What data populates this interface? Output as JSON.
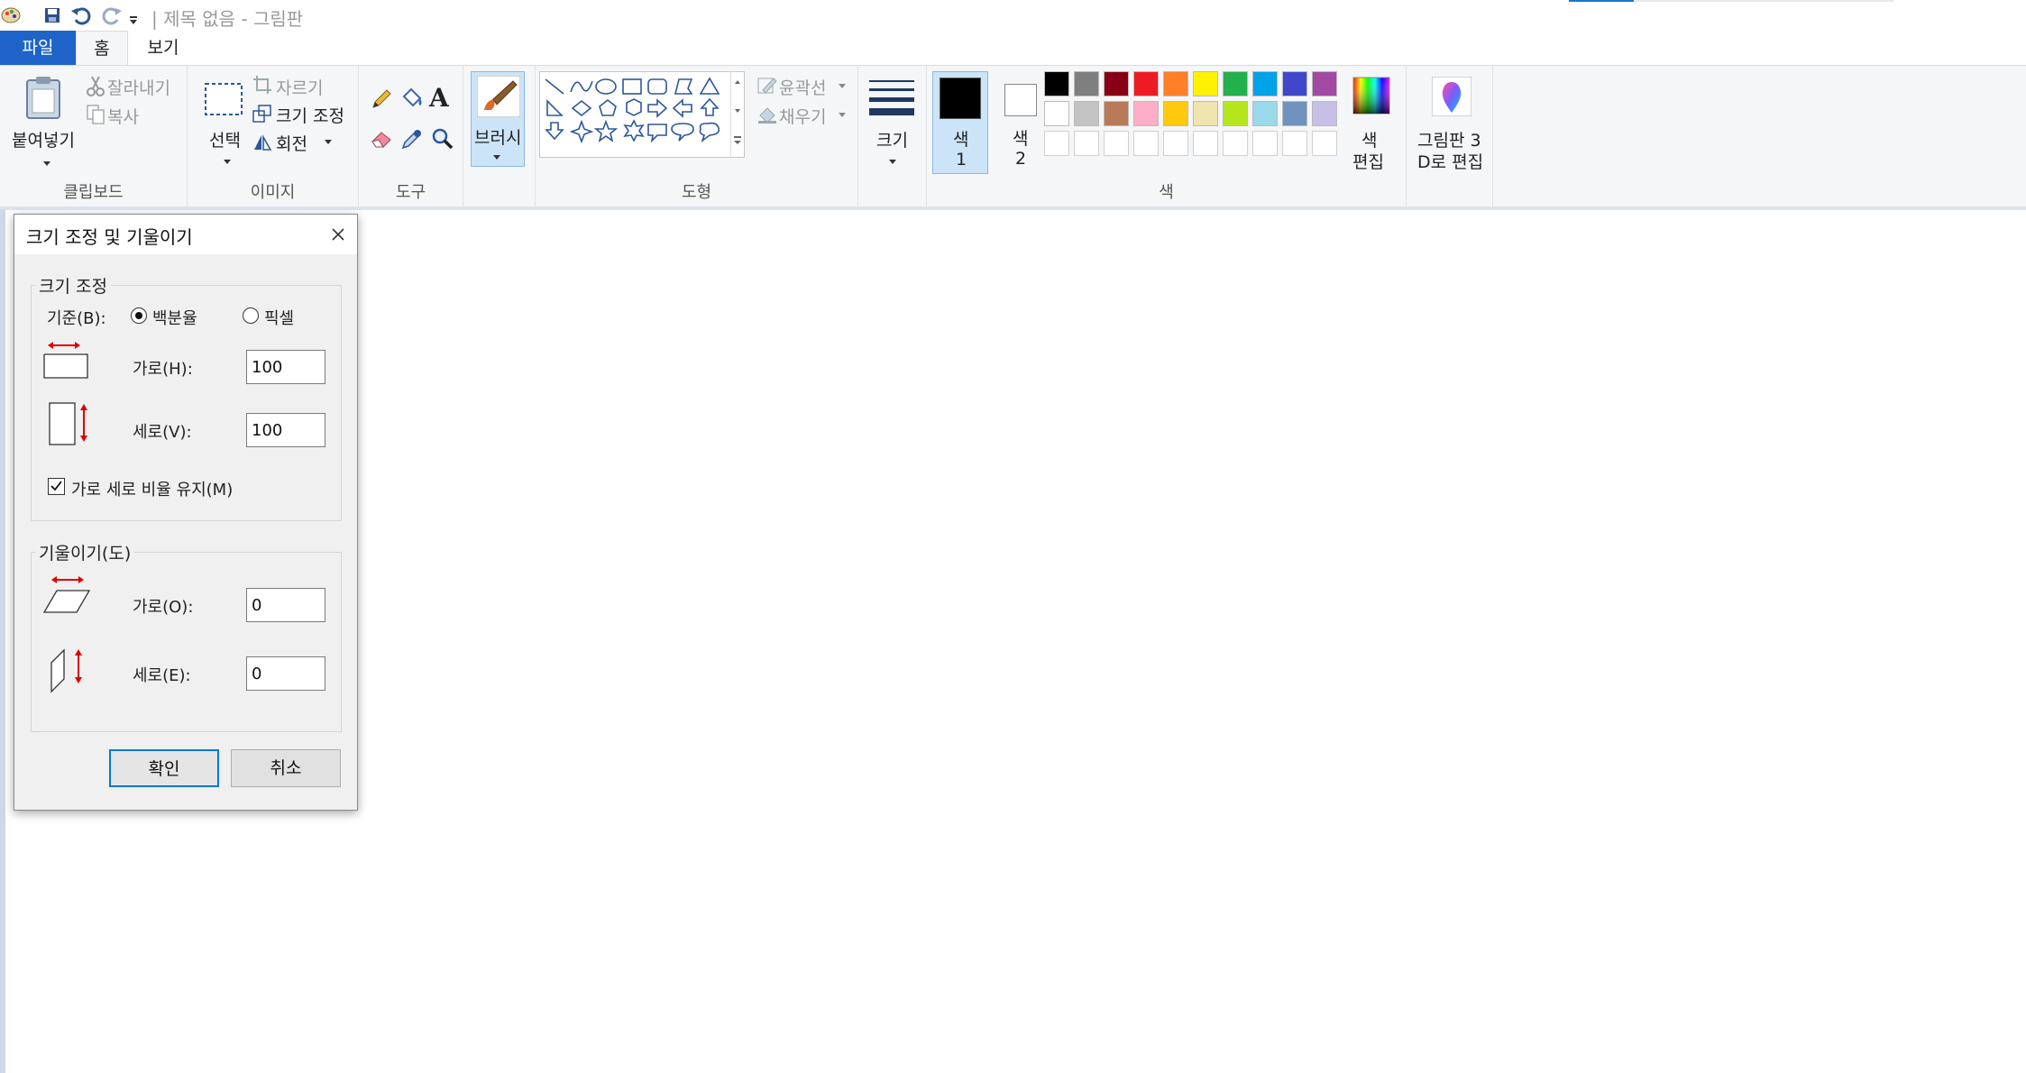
{
  "titlebar": {
    "title": "| 제목 없음 - 그림판",
    "icons": [
      "paint-app-icon",
      "save-icon",
      "undo-icon",
      "redo-icon",
      "customize-arrow-icon"
    ]
  },
  "tabs": {
    "file": "파일",
    "home": "홈",
    "view": "보기"
  },
  "ribbon": {
    "clipboard": {
      "paste": "붙여넣기",
      "cut": "잘라내기",
      "copy": "복사",
      "group": "클립보드"
    },
    "image": {
      "select": "선택",
      "crop": "자르기",
      "resize": "크기 조정",
      "rotate": "회전",
      "group": "이미지"
    },
    "tools": {
      "group": "도구"
    },
    "brushes": {
      "label": "브러시"
    },
    "shapes": {
      "outline": "윤곽선",
      "fill": "채우기",
      "group": "도형"
    },
    "size": {
      "label": "크기"
    },
    "colors": {
      "color1_a": "색",
      "color1_b": "1",
      "color2_a": "색",
      "color2_b": "2",
      "edit_a": "색",
      "edit_b": "편집",
      "group": "색",
      "row1": [
        "#000000",
        "#7f7f7f",
        "#880015",
        "#ed1c24",
        "#ff7f27",
        "#fff200",
        "#22b14c",
        "#00a2e8",
        "#3f48cc",
        "#a349a4"
      ],
      "row2": [
        "#ffffff",
        "#c3c3c3",
        "#b97a57",
        "#ffaec9",
        "#ffc90e",
        "#efe4b0",
        "#b5e61d",
        "#99d9ea",
        "#7092be",
        "#c8bfe7"
      ],
      "color1": "#000000",
      "color2": "#ffffff"
    },
    "paint3d": {
      "line1": "그림판 3",
      "line2": "D로 편집"
    }
  },
  "dialog": {
    "title": "크기 조정 및 기울이기",
    "resize_legend": "크기 조정",
    "basis_label": "기준(B):",
    "percent_label": "백분율",
    "pixel_label": "픽셀",
    "horizontal_label": "가로(H):",
    "horizontal_value": "100",
    "vertical_label": "세로(V):",
    "vertical_value": "100",
    "keep_ratio_label": "가로 세로 비율 유지(M)",
    "keep_ratio_checked": true,
    "skew_legend": "기울이기(도)",
    "skew_h_label": "가로(O):",
    "skew_h_value": "0",
    "skew_v_label": "세로(E):",
    "skew_v_value": "0",
    "ok": "확인",
    "cancel": "취소"
  }
}
